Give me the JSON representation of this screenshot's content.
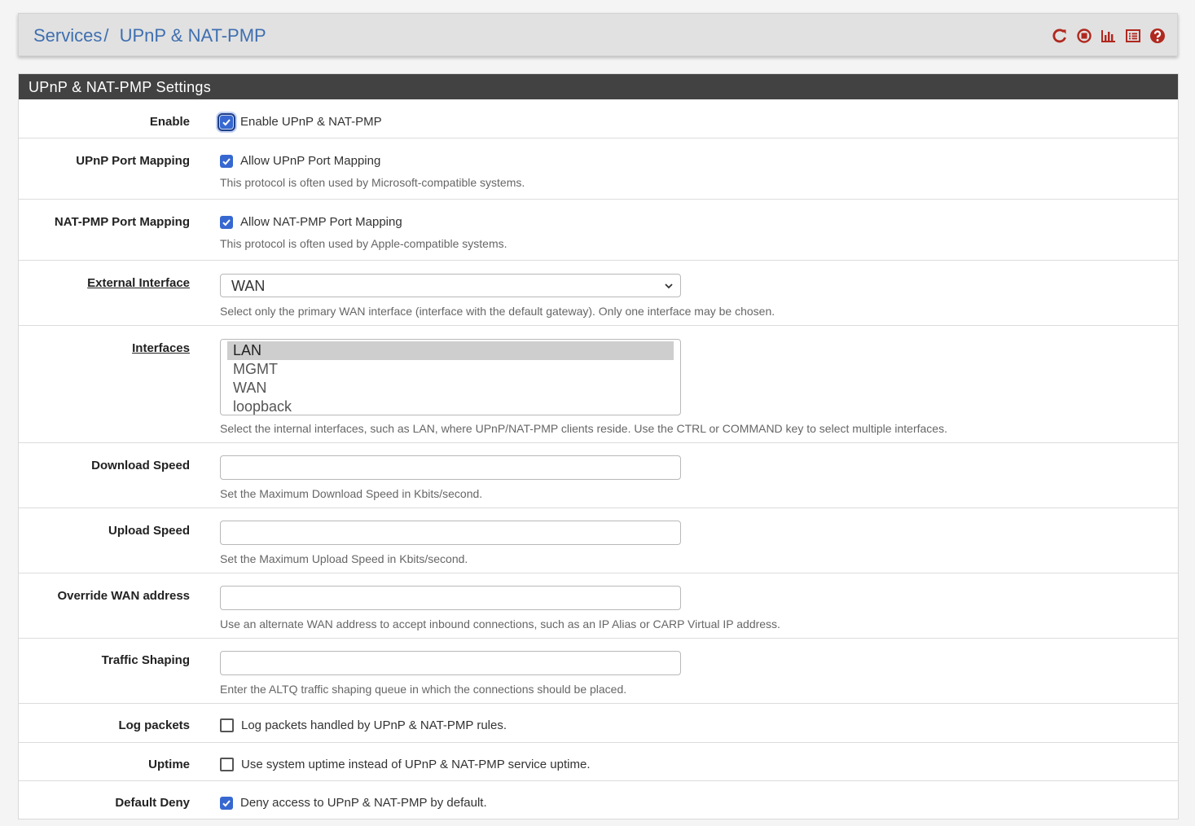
{
  "breadcrumb": {
    "parent": "Services",
    "separator": "/",
    "current": "UPnP & NAT-PMP"
  },
  "header_icons": [
    "restart-service-icon",
    "stop-service-icon",
    "status-graph-icon",
    "log-list-icon",
    "help-icon"
  ],
  "accent_color": "#3768d1",
  "panel_title": "UPnP & NAT-PMP Settings",
  "fields": {
    "enable": {
      "label": "Enable",
      "checkbox_label": "Enable UPnP & NAT-PMP",
      "checked": true
    },
    "upnp_port_mapping": {
      "label": "UPnP Port Mapping",
      "checkbox_label": "Allow UPnP Port Mapping",
      "checked": true,
      "help": "This protocol is often used by Microsoft-compatible systems."
    },
    "natpmp_port_mapping": {
      "label": "NAT-PMP Port Mapping",
      "checkbox_label": "Allow NAT-PMP Port Mapping",
      "checked": true,
      "help": "This protocol is often used by Apple-compatible systems."
    },
    "external_interface": {
      "label": "External Interface",
      "value": "WAN",
      "help": "Select only the primary WAN interface (interface with the default gateway). Only one interface may be chosen."
    },
    "interfaces": {
      "label": "Interfaces",
      "options": [
        "LAN",
        "MGMT",
        "WAN",
        "loopback"
      ],
      "selected": "LAN",
      "help": "Select the internal interfaces, such as LAN, where UPnP/NAT-PMP clients reside. Use the CTRL or COMMAND key to select multiple interfaces."
    },
    "download_speed": {
      "label": "Download Speed",
      "value": "",
      "help": "Set the Maximum Download Speed in Kbits/second."
    },
    "upload_speed": {
      "label": "Upload Speed",
      "value": "",
      "help": "Set the Maximum Upload Speed in Kbits/second."
    },
    "override_wan": {
      "label": "Override WAN address",
      "value": "",
      "help": "Use an alternate WAN address to accept inbound connections, such as an IP Alias or CARP Virtual IP address."
    },
    "traffic_shaping": {
      "label": "Traffic Shaping",
      "value": "",
      "help": "Enter the ALTQ traffic shaping queue in which the connections should be placed."
    },
    "log_packets": {
      "label": "Log packets",
      "checkbox_label": "Log packets handled by UPnP & NAT-PMP rules.",
      "checked": false
    },
    "uptime": {
      "label": "Uptime",
      "checkbox_label": "Use system uptime instead of UPnP & NAT-PMP service uptime.",
      "checked": false
    },
    "default_deny": {
      "label": "Default Deny",
      "checkbox_label": "Deny access to UPnP & NAT-PMP by default.",
      "checked": true
    }
  }
}
